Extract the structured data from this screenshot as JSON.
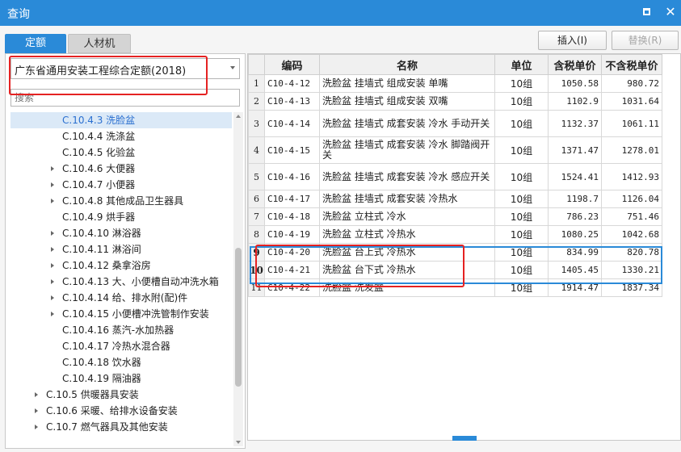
{
  "window": {
    "title": "查询"
  },
  "tabs": [
    {
      "label": "定额"
    },
    {
      "label": "人材机"
    }
  ],
  "toolbar": {
    "insert_label": "插入(I)",
    "replace_label": "替换(R)"
  },
  "library_select": {
    "value": "广东省通用安装工程综合定额(2018)"
  },
  "search": {
    "placeholder": "搜索"
  },
  "tree": [
    {
      "label": "C.10.4.3 洗脸盆",
      "selected": true,
      "expandable": false
    },
    {
      "label": "C.10.4.4 洗涤盆",
      "expandable": false
    },
    {
      "label": "C.10.4.5 化验盆",
      "expandable": false
    },
    {
      "label": "C.10.4.6 大便器",
      "expandable": true
    },
    {
      "label": "C.10.4.7 小便器",
      "expandable": true
    },
    {
      "label": "C.10.4.8 其他成品卫生器具",
      "expandable": true
    },
    {
      "label": "C.10.4.9 烘手器",
      "expandable": false
    },
    {
      "label": "C.10.4.10 淋浴器",
      "expandable": true
    },
    {
      "label": "C.10.4.11 淋浴间",
      "expandable": true
    },
    {
      "label": "C.10.4.12 桑拿浴房",
      "expandable": true
    },
    {
      "label": "C.10.4.13 大、小便槽自动冲洗水箱",
      "expandable": true
    },
    {
      "label": "C.10.4.14 给、排水附(配)件",
      "expandable": true
    },
    {
      "label": "C.10.4.15 小便槽冲洗管制作安装",
      "expandable": true
    },
    {
      "label": "C.10.4.16 蒸汽-水加热器",
      "expandable": false
    },
    {
      "label": "C.10.4.17 冷热水混合器",
      "expandable": false
    },
    {
      "label": "C.10.4.18 饮水器",
      "expandable": false
    },
    {
      "label": "C.10.4.19 隔油器",
      "expandable": false
    },
    {
      "label": "C.10.5 供暖器具安装",
      "expandable": true,
      "level": 1
    },
    {
      "label": "C.10.6 采暖、给排水设备安装",
      "expandable": true,
      "level": 1
    },
    {
      "label": "C.10.7 燃气器具及其他安装",
      "expandable": true,
      "level": 1
    }
  ],
  "table": {
    "columns": [
      "",
      "编码",
      "名称",
      "单位",
      "含税单价",
      "不含税单价"
    ],
    "rows": [
      {
        "idx": "1",
        "code": "C10-4-12",
        "name": "洗脸盆 挂墙式 组成安装 单嘴",
        "unit": "10组",
        "price_tax": "1050.58",
        "price_notax": "980.72"
      },
      {
        "idx": "2",
        "code": "C10-4-13",
        "name": "洗脸盆 挂墙式 组成安装 双嘴",
        "unit": "10组",
        "price_tax": "1102.9",
        "price_notax": "1031.64"
      },
      {
        "idx": "3",
        "code": "C10-4-14",
        "name": "洗脸盆 挂墙式 成套安装 冷水 手动开关",
        "unit": "10组",
        "price_tax": "1132.37",
        "price_notax": "1061.11"
      },
      {
        "idx": "4",
        "code": "C10-4-15",
        "name": "洗脸盆 挂墙式 成套安装 冷水 脚踏阀开关",
        "unit": "10组",
        "price_tax": "1371.47",
        "price_notax": "1278.01"
      },
      {
        "idx": "5",
        "code": "C10-4-16",
        "name": "洗脸盆 挂墙式 成套安装 冷水 感应开关",
        "unit": "10组",
        "price_tax": "1524.41",
        "price_notax": "1412.93"
      },
      {
        "idx": "6",
        "code": "C10-4-17",
        "name": "洗脸盆 挂墙式 成套安装 冷热水",
        "unit": "10组",
        "price_tax": "1198.7",
        "price_notax": "1126.04"
      },
      {
        "idx": "7",
        "code": "C10-4-18",
        "name": "洗脸盆 立柱式 冷水",
        "unit": "10组",
        "price_tax": "786.23",
        "price_notax": "751.46"
      },
      {
        "idx": "8",
        "code": "C10-4-19",
        "name": "洗脸盆 立柱式 冷热水",
        "unit": "10组",
        "price_tax": "1080.25",
        "price_notax": "1042.68"
      },
      {
        "idx": "9",
        "code": "C10-4-20",
        "name": "洗脸盆 台上式 冷热水",
        "unit": "10组",
        "price_tax": "834.99",
        "price_notax": "820.78"
      },
      {
        "idx": "10",
        "code": "C10-4-21",
        "name": "洗脸盆 台下式 冷热水",
        "unit": "10组",
        "price_tax": "1405.45",
        "price_notax": "1330.21"
      },
      {
        "idx": "11",
        "code": "C10-4-22",
        "name": "洗脸盆 洗发盆",
        "unit": "10组",
        "price_tax": "1914.47",
        "price_notax": "1837.34"
      }
    ]
  },
  "colors": {
    "accent": "#2a8ad8",
    "highlight_red": "#e52222",
    "selection_bg": "#dbe9f7"
  }
}
